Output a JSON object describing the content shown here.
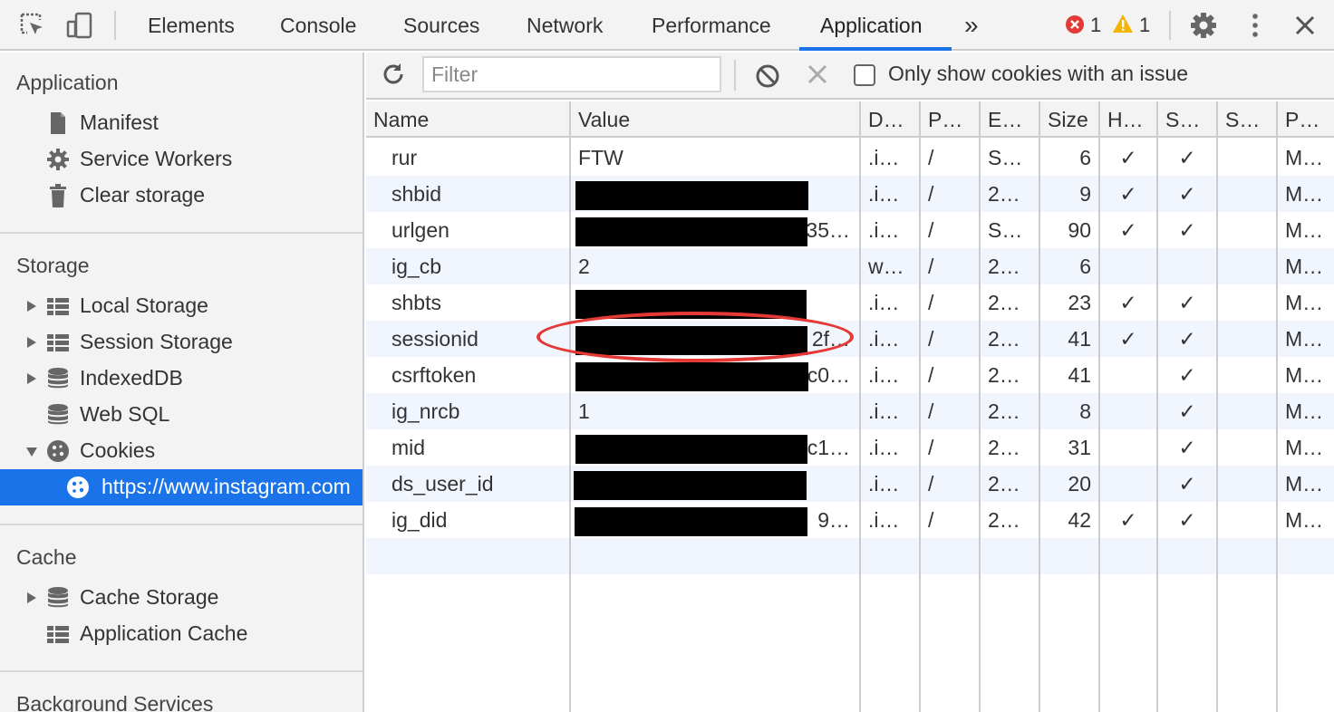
{
  "toolbar": {
    "tabs": [
      "Elements",
      "Console",
      "Sources",
      "Network",
      "Performance",
      "Application"
    ],
    "more": "»",
    "errors_count": "1",
    "warnings_count": "1"
  },
  "sidebar": {
    "application_title": "Application",
    "application_items": [
      "Manifest",
      "Service Workers",
      "Clear storage"
    ],
    "storage_title": "Storage",
    "storage_items": [
      "Local Storage",
      "Session Storage",
      "IndexedDB",
      "Web SQL",
      "Cookies"
    ],
    "cookie_origin": "https://www.instagram.com",
    "cache_title": "Cache",
    "cache_items": [
      "Cache Storage",
      "Application Cache"
    ],
    "background_title": "Background Services"
  },
  "filter_bar": {
    "filter_placeholder": "Filter",
    "only_issues_label": "Only show cookies with an issue"
  },
  "cookies_table": {
    "columns": [
      "Name",
      "Value",
      "D…",
      "P…",
      "E…",
      "Size",
      "H…",
      "S…",
      "S…",
      "P…"
    ],
    "rows": [
      {
        "name": "rur",
        "value": "FTW",
        "domain": ".i…",
        "path": "/",
        "expires": "S…",
        "size": "6",
        "httponly": "✓",
        "secure": "✓",
        "priority": "M…"
      },
      {
        "name": "shbid",
        "value": "",
        "domain": ".i…",
        "path": "/",
        "expires": "2…",
        "size": "9",
        "httponly": "✓",
        "secure": "✓",
        "priority": "M…"
      },
      {
        "name": "urlgen",
        "value": "35…",
        "domain": ".i…",
        "path": "/",
        "expires": "S…",
        "size": "90",
        "httponly": "✓",
        "secure": "✓",
        "priority": "M…"
      },
      {
        "name": "ig_cb",
        "value": "2",
        "domain": "w…",
        "path": "/",
        "expires": "2…",
        "size": "6",
        "httponly": "",
        "secure": "",
        "priority": "M…"
      },
      {
        "name": "shbts",
        "value": "",
        "domain": ".i…",
        "path": "/",
        "expires": "2…",
        "size": "23",
        "httponly": "✓",
        "secure": "✓",
        "priority": "M…"
      },
      {
        "name": "sessionid",
        "value": "2f…",
        "domain": ".i…",
        "path": "/",
        "expires": "2…",
        "size": "41",
        "httponly": "✓",
        "secure": "✓",
        "priority": "M…"
      },
      {
        "name": "csrftoken",
        "value": "c0…",
        "domain": ".i…",
        "path": "/",
        "expires": "2…",
        "size": "41",
        "httponly": "",
        "secure": "✓",
        "priority": "M…"
      },
      {
        "name": "ig_nrcb",
        "value": "1",
        "domain": ".i…",
        "path": "/",
        "expires": "2…",
        "size": "8",
        "httponly": "",
        "secure": "✓",
        "priority": "M…"
      },
      {
        "name": "mid",
        "value": "c1…",
        "domain": ".i…",
        "path": "/",
        "expires": "2…",
        "size": "31",
        "httponly": "",
        "secure": "✓",
        "priority": "M…"
      },
      {
        "name": "ds_user_id",
        "value": "",
        "domain": ".i…",
        "path": "/",
        "expires": "2…",
        "size": "20",
        "httponly": "",
        "secure": "✓",
        "priority": "M…"
      },
      {
        "name": "ig_did",
        "value": "9…",
        "domain": ".i…",
        "path": "/",
        "expires": "2…",
        "size": "42",
        "httponly": "✓",
        "secure": "✓",
        "priority": "M…"
      }
    ]
  }
}
